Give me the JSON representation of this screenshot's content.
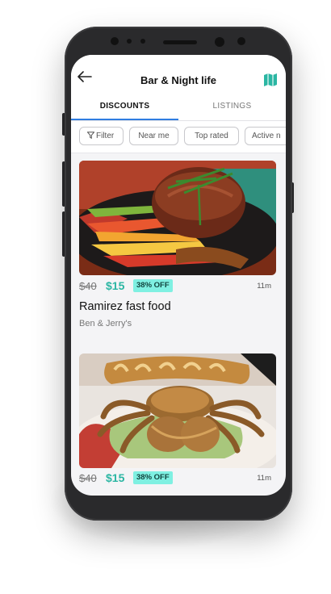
{
  "header": {
    "title": "Bar & Night life"
  },
  "tabs": [
    {
      "label": "DISCOUNTS",
      "active": true
    },
    {
      "label": "LISTINGS",
      "active": false
    }
  ],
  "filters": [
    "Filter",
    "Near me",
    "Top rated",
    "Active n"
  ],
  "icons": {
    "back": "arrow-left-icon",
    "map": "map-icon",
    "filter": "filter-funnel-icon"
  },
  "colors": {
    "accent": "#2f7de1",
    "price": "#2bb6a3",
    "badge": "#7ff0e2"
  },
  "cards": [
    {
      "old_price": "$40",
      "new_price": "$15",
      "discount": "38% OFF",
      "distance": "11m",
      "name": "Ramirez fast food",
      "subtitle": "Ben & Jerry's"
    },
    {
      "old_price": "$40",
      "new_price": "$15",
      "discount": "38% OFF",
      "distance": "11m"
    }
  ]
}
